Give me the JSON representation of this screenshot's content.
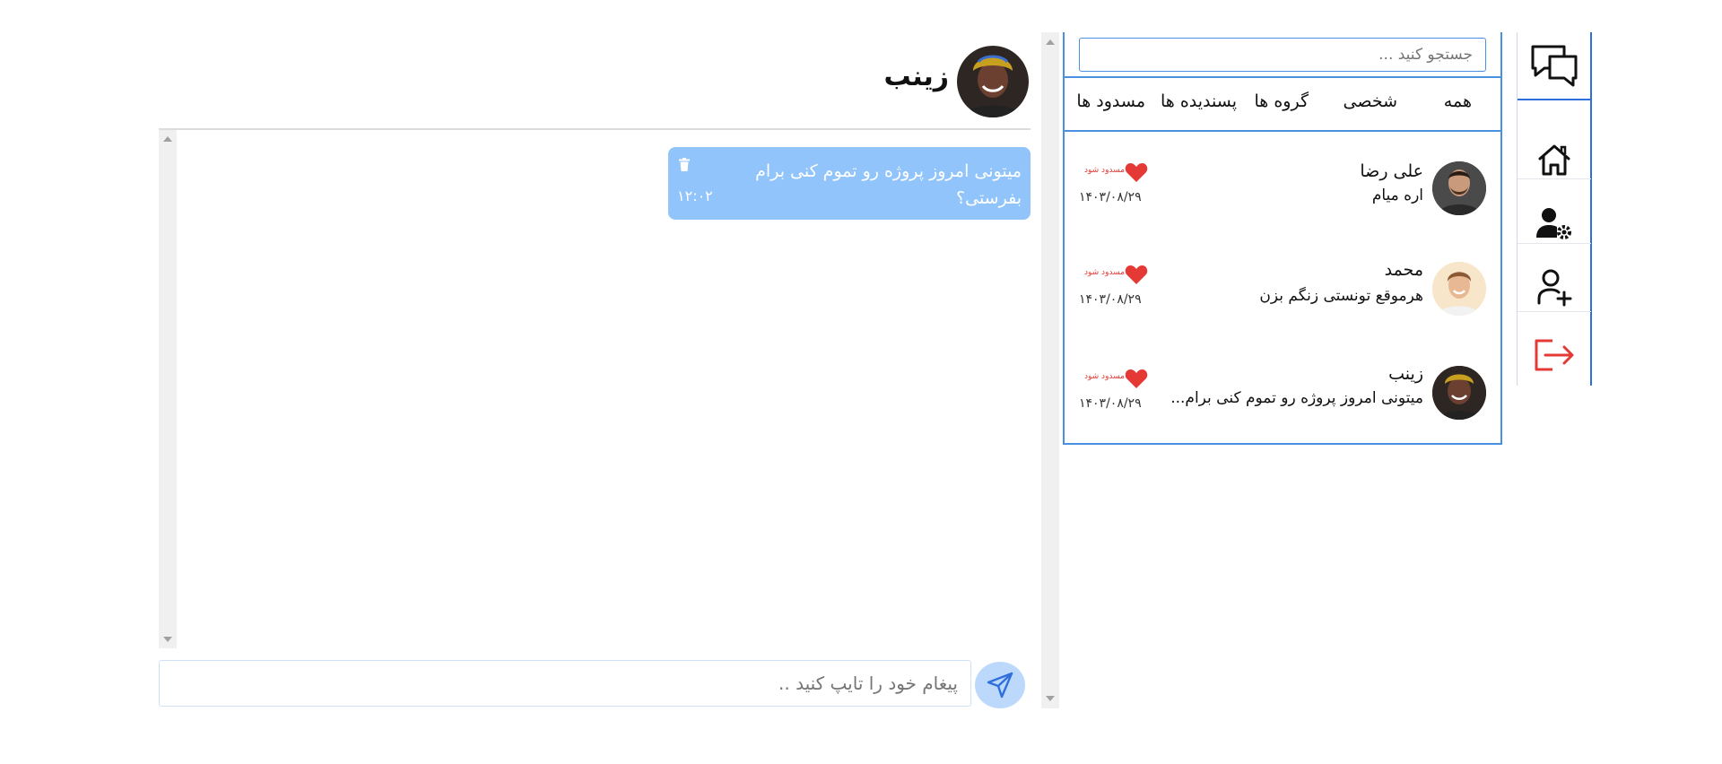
{
  "rail": {
    "icons": [
      "chat-bubbles-icon",
      "home-icon",
      "user-settings-icon",
      "user-add-icon",
      "logout-icon"
    ]
  },
  "search": {
    "placeholder": "جستجو کنید ..."
  },
  "tabs": [
    {
      "label": "همه"
    },
    {
      "label": "شخصی"
    },
    {
      "label": "گروه ها"
    },
    {
      "label": "پسندیده ها"
    },
    {
      "label": "مسدود ها"
    }
  ],
  "contacts": [
    {
      "name": "علی رضا",
      "message": "اره میام",
      "date": "۱۴۰۳/۰۸/۲۹",
      "block_label": "مسدود شود"
    },
    {
      "name": "محمد",
      "message": "هرموقع تونستی زنگم بزن",
      "date": "۱۴۰۳/۰۸/۲۹",
      "block_label": "مسدود شود"
    },
    {
      "name": "زینب",
      "message": "میتونی امروز پروژه رو تموم کنی برام...",
      "date": "۱۴۰۳/۰۸/۲۹",
      "block_label": "مسدود شود"
    }
  ],
  "chat": {
    "name": "زینب",
    "messages": [
      {
        "text": "میتونی امروز پروژه رو تموم کنی برام بفرستی؟",
        "time": "۱۲:۰۲"
      }
    ],
    "input_placeholder": "پیغام خود را تایپ کنید .."
  },
  "colors": {
    "accent": "#4a90e2",
    "bubble": "#90c4fb",
    "heart": "#e53935",
    "logout": "#e53935",
    "send_button": "#bcd9fb"
  }
}
